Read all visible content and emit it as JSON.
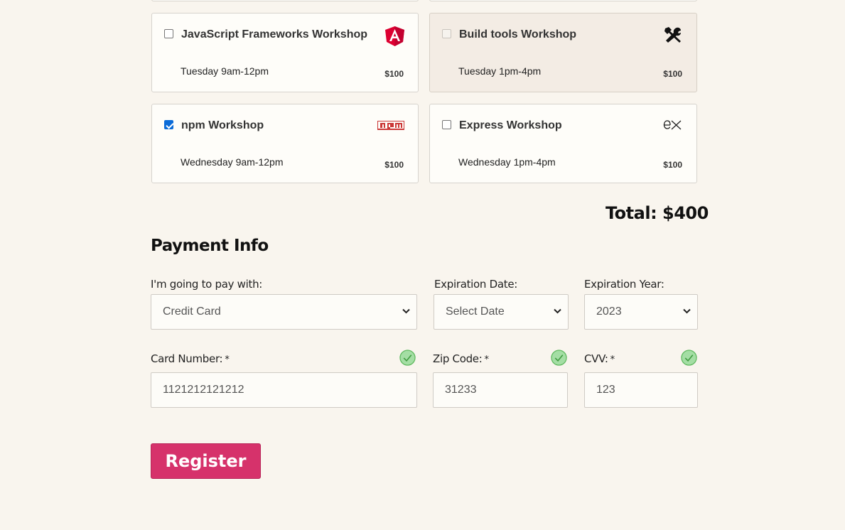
{
  "workshops": [
    {
      "title": "JavaScript Frameworks Workshop",
      "when": "Tuesday 9am-12pm",
      "price": "$100",
      "checked": false,
      "disabled": false,
      "icon": "angular-icon"
    },
    {
      "title": "Build tools Workshop",
      "when": "Tuesday 1pm-4pm",
      "price": "$100",
      "checked": false,
      "disabled": true,
      "icon": "tools-icon"
    },
    {
      "title": "npm Workshop",
      "when": "Wednesday 9am-12pm",
      "price": "$100",
      "checked": true,
      "disabled": false,
      "icon": "npm-icon"
    },
    {
      "title": "Express Workshop",
      "when": "Wednesday 1pm-4pm",
      "price": "$100",
      "checked": false,
      "disabled": false,
      "icon": "express-icon"
    }
  ],
  "total": "Total: $400",
  "payment": {
    "heading": "Payment Info",
    "pay_with_label": "I'm going to pay with:",
    "pay_with_value": "Credit Card",
    "exp_date_label": "Expiration Date:",
    "exp_date_value": "Select Date",
    "exp_year_label": "Expiration Year:",
    "exp_year_value": "2023",
    "card_number_label": "Card Number:",
    "card_number_value": "1121212121212",
    "zip_label": "Zip Code:",
    "zip_value": "31233",
    "cvv_label": "CVV:",
    "cvv_value": "123",
    "required_mark": "*"
  },
  "register_label": "Register",
  "colors": {
    "background": "#f9f5ee",
    "accent": "#d6326b",
    "valid": "#5cb85c",
    "checkbox": "#0b6bd8"
  }
}
